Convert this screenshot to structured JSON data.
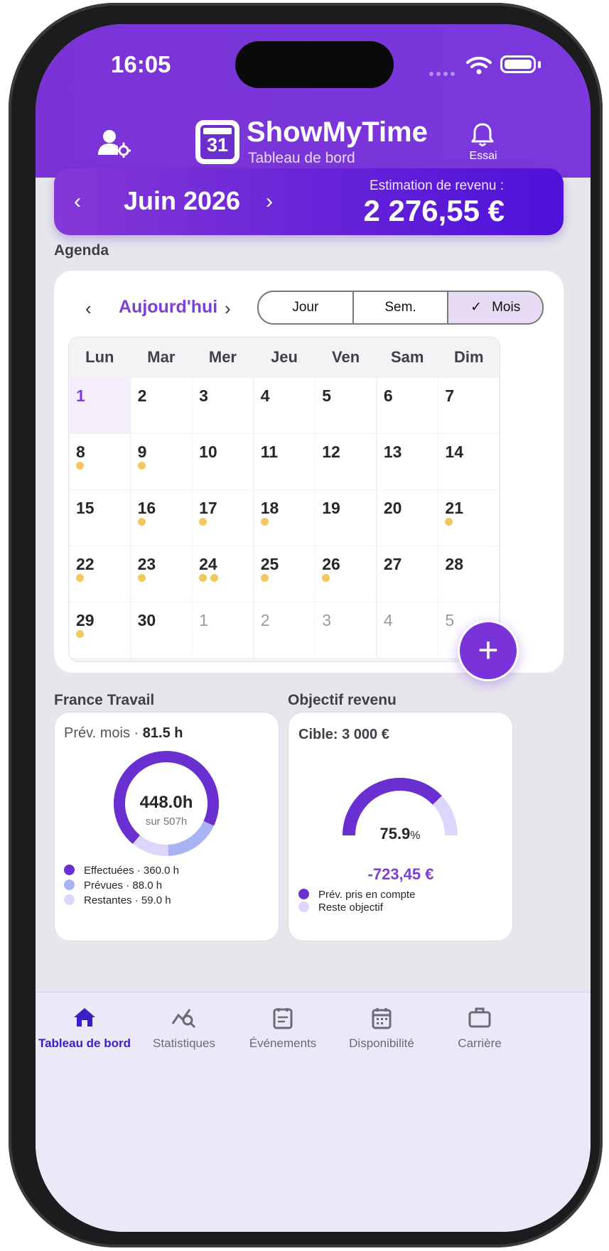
{
  "status_bar": {
    "time": "16:05"
  },
  "header": {
    "title": "ShowMyTime",
    "subtitle": "Tableau de bord",
    "logo_number": "31",
    "bell_label": "Essai"
  },
  "month_bar": {
    "month": "Juin 2026",
    "prev": "‹",
    "next": "›",
    "estimate_label": "Estimation de revenu :",
    "estimate_value": "2 276,55 €"
  },
  "agenda": {
    "section_label": "Agenda",
    "today_label": "Aujourd'hui",
    "prev": "‹",
    "next": "›",
    "views": [
      "Jour",
      "Sem.",
      "Mois"
    ],
    "selected_view": "Mois",
    "weekdays": [
      "Lun",
      "Mar",
      "Mer",
      "Jeu",
      "Ven",
      "Sam",
      "Dim"
    ],
    "days": [
      {
        "n": "1",
        "dots": 0,
        "today": true
      },
      {
        "n": "2",
        "dots": 0
      },
      {
        "n": "3",
        "dots": 0
      },
      {
        "n": "4",
        "dots": 0
      },
      {
        "n": "5",
        "dots": 0
      },
      {
        "n": "6",
        "dots": 0
      },
      {
        "n": "7",
        "dots": 0
      },
      {
        "n": "8",
        "dots": 1
      },
      {
        "n": "9",
        "dots": 1
      },
      {
        "n": "10",
        "dots": 0
      },
      {
        "n": "11",
        "dots": 0
      },
      {
        "n": "12",
        "dots": 0
      },
      {
        "n": "13",
        "dots": 0
      },
      {
        "n": "14",
        "dots": 0
      },
      {
        "n": "15",
        "dots": 0
      },
      {
        "n": "16",
        "dots": 1
      },
      {
        "n": "17",
        "dots": 1
      },
      {
        "n": "18",
        "dots": 1
      },
      {
        "n": "19",
        "dots": 0
      },
      {
        "n": "20",
        "dots": 0
      },
      {
        "n": "21",
        "dots": 1
      },
      {
        "n": "22",
        "dots": 1
      },
      {
        "n": "23",
        "dots": 1
      },
      {
        "n": "24",
        "dots": 2
      },
      {
        "n": "25",
        "dots": 1
      },
      {
        "n": "26",
        "dots": 1
      },
      {
        "n": "27",
        "dots": 0
      },
      {
        "n": "28",
        "dots": 0
      },
      {
        "n": "29",
        "dots": 1
      },
      {
        "n": "30",
        "dots": 0
      },
      {
        "n": "1",
        "dots": 0,
        "other": true
      },
      {
        "n": "2",
        "dots": 0,
        "other": true
      },
      {
        "n": "3",
        "dots": 0,
        "other": true
      },
      {
        "n": "4",
        "dots": 0,
        "other": true
      },
      {
        "n": "5",
        "dots": 0,
        "other": true
      }
    ],
    "fab_label": "+"
  },
  "france_travail": {
    "section_label": "France Travail",
    "prev_label": "Prév. mois · ",
    "prev_value": "81.5 h",
    "center_value": "448.0h",
    "center_sub": "sur 507h",
    "total_hours": 507,
    "segments": [
      {
        "label": "Effectuées · 360.0 h",
        "value": 360.0,
        "color": "#6a2fd1"
      },
      {
        "label": "Prévues · 88.0 h",
        "value": 88.0,
        "color": "#a9b2f3"
      },
      {
        "label": "Restantes · 59.0 h",
        "value": 59.0,
        "color": "#ddd6fa"
      }
    ]
  },
  "objectif": {
    "section_label": "Objectif revenu",
    "target": "Cible: 3 000 €",
    "percent_value": 75.9,
    "percent_text": "75.9",
    "percent_unit": "%",
    "delta": "-723,45 €",
    "legend": [
      {
        "label": "Prév. pris en compte",
        "color": "#6a2fd1"
      },
      {
        "label": "Reste objectif",
        "color": "#ddd6fa"
      }
    ]
  },
  "tabbar": {
    "tabs": [
      {
        "label": "Tableau de bord",
        "icon": "home-icon",
        "active": true
      },
      {
        "label": "Statistiques",
        "icon": "chart-search-icon"
      },
      {
        "label": "Événements",
        "icon": "document-icon"
      },
      {
        "label": "Disponibilité",
        "icon": "calendar-icon"
      },
      {
        "label": "Carrière",
        "icon": "briefcase-icon"
      }
    ]
  },
  "colors": {
    "primary": "#7b33d6",
    "accent_dot": "#f2c85f",
    "active_tab": "#3a1fc6"
  }
}
